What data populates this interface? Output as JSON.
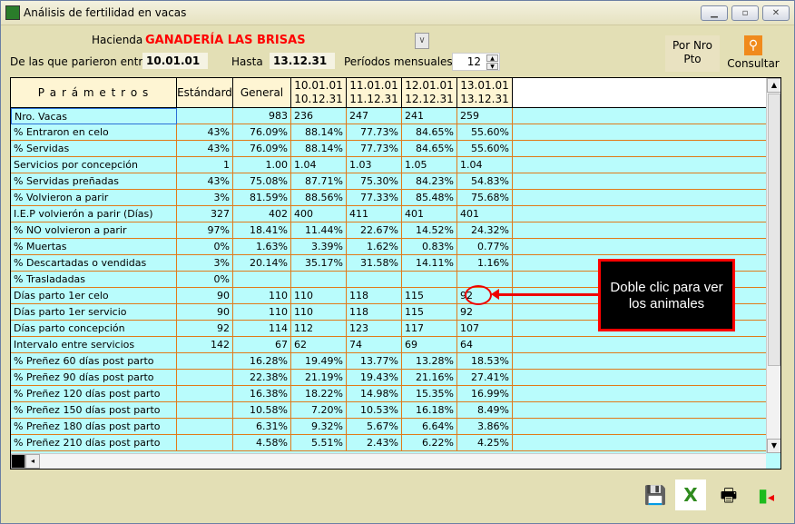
{
  "window": {
    "title": "Análisis de fertilidad en vacas"
  },
  "form": {
    "hacienda_label": "Hacienda",
    "hacienda_value": "GANADERÍA LAS BRISAS",
    "parieron_label": "De las que parieron entre",
    "desde": "10.01.01",
    "hasta_label": "Hasta",
    "hasta": "13.12.31",
    "periodos_label": "Períodos mensuales",
    "periodos": "12",
    "por_nro_line1": "Por Nro",
    "por_nro_line2": "Pto",
    "consultar": "Consultar"
  },
  "table": {
    "headers": [
      "P a r á m e t r o s",
      "Estándard",
      "General"
    ],
    "periods": [
      [
        "10.01.01",
        "10.12.31"
      ],
      [
        "11.01.01",
        "11.12.31"
      ],
      [
        "12.01.01",
        "12.12.31"
      ],
      [
        "13.01.01",
        "13.12.31"
      ]
    ],
    "rows": [
      [
        "Nro. Vacas",
        "",
        "983",
        "236",
        "247",
        "241",
        "259"
      ],
      [
        "% Entraron en celo",
        "43%",
        "76.09%",
        "88.14%",
        "77.73%",
        "84.65%",
        "55.60%"
      ],
      [
        "% Servidas",
        "43%",
        "76.09%",
        "88.14%",
        "77.73%",
        "84.65%",
        "55.60%"
      ],
      [
        "Servicios por concepción",
        "1",
        "1.00",
        "1.04",
        "1.03",
        "1.05",
        "1.04"
      ],
      [
        "% Servidas preñadas",
        "43%",
        "75.08%",
        "87.71%",
        "75.30%",
        "84.23%",
        "54.83%"
      ],
      [
        "% Volvieron a parir",
        "3%",
        "81.59%",
        "88.56%",
        "77.33%",
        "85.48%",
        "75.68%"
      ],
      [
        "I.E.P volvierón a parir (Días)",
        "327",
        "402",
        "400",
        "411",
        "401",
        "401"
      ],
      [
        "% NO volvieron a parir",
        "97%",
        "18.41%",
        "11.44%",
        "22.67%",
        "14.52%",
        "24.32%"
      ],
      [
        "% Muertas",
        "0%",
        "1.63%",
        "3.39%",
        "1.62%",
        "0.83%",
        "0.77%"
      ],
      [
        "% Descartadas o vendidas",
        "3%",
        "20.14%",
        "35.17%",
        "31.58%",
        "14.11%",
        "1.16%"
      ],
      [
        "% Trasladadas",
        "0%",
        "",
        "",
        "",
        "",
        ""
      ],
      [
        "Días parto 1er celo",
        "90",
        "110",
        "110",
        "118",
        "115",
        "92"
      ],
      [
        "Días parto 1er servicio",
        "90",
        "110",
        "110",
        "118",
        "115",
        "92"
      ],
      [
        "Días parto concepción",
        "92",
        "114",
        "112",
        "123",
        "117",
        "107"
      ],
      [
        "Intervalo entre servicios",
        "142",
        "67",
        "62",
        "74",
        "69",
        "64"
      ],
      [
        "% Preñez 60 días post parto",
        "",
        "16.28%",
        "19.49%",
        "13.77%",
        "13.28%",
        "18.53%"
      ],
      [
        "% Preñez 90 días post parto",
        "",
        "22.38%",
        "21.19%",
        "19.43%",
        "21.16%",
        "27.41%"
      ],
      [
        "% Preñez 120 días post parto",
        "",
        "16.38%",
        "18.22%",
        "14.98%",
        "15.35%",
        "16.99%"
      ],
      [
        "% Preñez 150 días post parto",
        "",
        "10.58%",
        "7.20%",
        "10.53%",
        "16.18%",
        "8.49%"
      ],
      [
        "% Preñez 180 días post parto",
        "",
        "6.31%",
        "9.32%",
        "5.67%",
        "6.64%",
        "3.86%"
      ],
      [
        "% Preñez 210 días post parto",
        "",
        "4.58%",
        "5.51%",
        "2.43%",
        "6.22%",
        "4.25%"
      ]
    ]
  },
  "tooltip": {
    "line1": "Doble clic para ver",
    "line2": "los animales"
  }
}
